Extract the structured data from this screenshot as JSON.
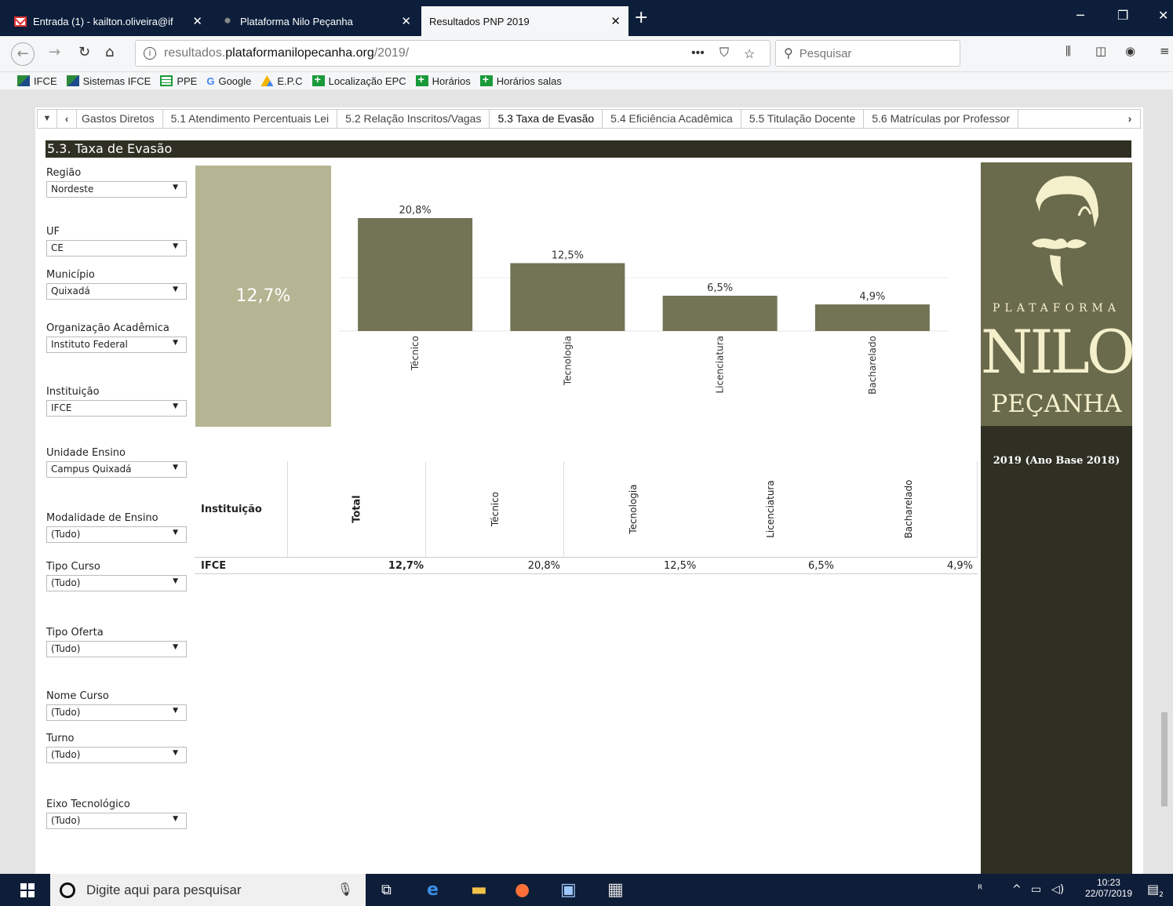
{
  "browser": {
    "tabs": [
      {
        "title": "Entrada (1) - kailton.oliveira@if",
        "icon": "gmail-icon"
      },
      {
        "title": "Plataforma Nilo Peçanha",
        "icon": "nilo-favicon"
      },
      {
        "title": "Resultados PNP 2019",
        "active": true
      }
    ],
    "url_prefix": "resultados.",
    "url_host": "plataformanilopecanha.org",
    "url_path": "/2019/",
    "url_menu": "•••",
    "search_placeholder": "Pesquisar",
    "bookmarks": [
      "IFCE",
      "Sistemas IFCE",
      "PPE",
      "Google",
      "E.P.C",
      "Localização EPC",
      "Horários",
      "Horários salas"
    ]
  },
  "sheet_tabs": [
    "Gastos Diretos",
    "5.1 Atendimento Percentuais Lei",
    "5.2 Relação Inscritos/Vagas",
    "5.3 Taxa de Evasão",
    "5.4 Eficiência Acadêmica",
    "5.5 Titulação Docente",
    "5.6 Matrículas por Professor"
  ],
  "active_sheet": "5.3 Taxa de Evasão",
  "page_title": "5.3. Taxa de Evasão",
  "filters": [
    {
      "label": "Região",
      "value": "Nordeste"
    },
    {
      "label": "UF",
      "value": "CE"
    },
    {
      "label": "Município",
      "value": "Quixadá"
    },
    {
      "label": "Organização Acadêmica",
      "value": "Instituto Federal"
    },
    {
      "label": "Instituição",
      "value": "IFCE"
    },
    {
      "label": "Unidade Ensino",
      "value": "Campus Quixadá"
    },
    {
      "label": "Modalidade de Ensino",
      "value": "(Tudo)"
    },
    {
      "label": "Tipo Curso",
      "value": "(Tudo)"
    },
    {
      "label": "Tipo Oferta",
      "value": "(Tudo)"
    },
    {
      "label": "Nome Curso",
      "value": "(Tudo)"
    },
    {
      "label": "Turno",
      "value": "(Tudo)"
    },
    {
      "label": "Eixo Tecnológico",
      "value": "(Tudo)"
    }
  ],
  "kpi_total": "12,7%",
  "chart_data": {
    "type": "bar",
    "categories": [
      "Técnico",
      "Tecnologia",
      "Licenciatura",
      "Bacharelado"
    ],
    "values": [
      20.8,
      12.5,
      6.5,
      4.9
    ],
    "labels": [
      "20,8%",
      "12,5%",
      "6,5%",
      "4,9%"
    ],
    "ylim": [
      0,
      20.8
    ],
    "color": "#737356"
  },
  "table": {
    "row_header": "Instituição",
    "columns": [
      "Total",
      "Técnico",
      "Tecnologia",
      "Licenciatura",
      "Bacharelado"
    ],
    "row": {
      "name": "IFCE",
      "values": [
        "12,7%",
        "20,8%",
        "12,5%",
        "6,5%",
        "4,9%"
      ]
    }
  },
  "brand": {
    "plataforma": "PLATAFORMA",
    "nilo": "NILO",
    "pecanha": "PEÇANHA",
    "year": "2019 (Ano Base 2018)"
  },
  "taskbar": {
    "search_placeholder": "Digite aqui para pesquisar",
    "time": "10:23",
    "date": "22/07/2019",
    "notifications": "2"
  }
}
